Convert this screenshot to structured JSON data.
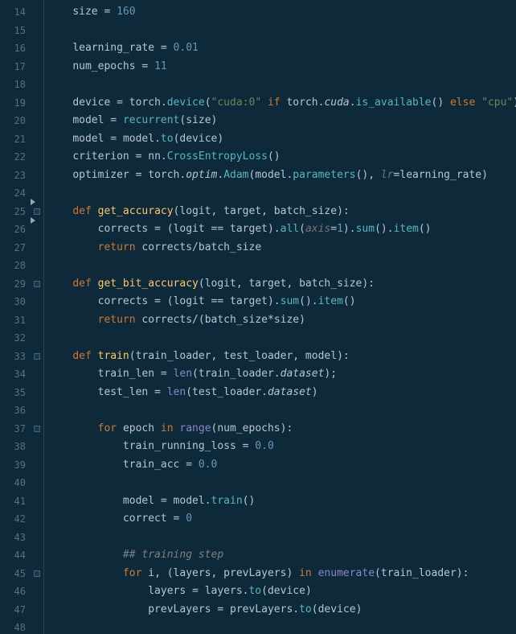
{
  "first_line_number": 14,
  "line_count": 35,
  "fold_markers": [
    25,
    29,
    33,
    37,
    45
  ],
  "triangle_markers": [
    24.5,
    25.5
  ],
  "lines": [
    [
      [
        "    ",
        ""
      ],
      [
        "size",
        "ident"
      ],
      [
        " = ",
        "op"
      ],
      [
        "160",
        "num"
      ]
    ],
    [],
    [
      [
        "    ",
        ""
      ],
      [
        "learning_rate",
        "ident"
      ],
      [
        " = ",
        "op"
      ],
      [
        "0.01",
        "num"
      ]
    ],
    [
      [
        "    ",
        ""
      ],
      [
        "num_epochs",
        "ident"
      ],
      [
        " = ",
        "op"
      ],
      [
        "11",
        "num"
      ]
    ],
    [],
    [
      [
        "    ",
        ""
      ],
      [
        "device",
        "ident"
      ],
      [
        " = ",
        "op"
      ],
      [
        "torch",
        "ident"
      ],
      [
        ".",
        "punct"
      ],
      [
        "device",
        "call"
      ],
      [
        "(",
        "punct"
      ],
      [
        "\"cuda:0\"",
        "str"
      ],
      [
        " ",
        "op"
      ],
      [
        "if",
        "kw"
      ],
      [
        " ",
        "op"
      ],
      [
        "torch",
        "ident"
      ],
      [
        ".",
        "punct"
      ],
      [
        "cuda",
        "itattr"
      ],
      [
        ".",
        "punct"
      ],
      [
        "is_available",
        "call"
      ],
      [
        "()",
        "punct"
      ],
      [
        " ",
        "op"
      ],
      [
        "else",
        "kw"
      ],
      [
        " ",
        "op"
      ],
      [
        "\"cpu\"",
        "str"
      ],
      [
        ")",
        "punct"
      ]
    ],
    [
      [
        "    ",
        ""
      ],
      [
        "model",
        "ident"
      ],
      [
        " = ",
        "op"
      ],
      [
        "recurrent",
        "call"
      ],
      [
        "(",
        "punct"
      ],
      [
        "size",
        "ident"
      ],
      [
        ")",
        "punct"
      ]
    ],
    [
      [
        "    ",
        ""
      ],
      [
        "model",
        "ident"
      ],
      [
        " = ",
        "op"
      ],
      [
        "model",
        "ident"
      ],
      [
        ".",
        "punct"
      ],
      [
        "to",
        "call"
      ],
      [
        "(",
        "punct"
      ],
      [
        "device",
        "ident"
      ],
      [
        ")",
        "punct"
      ]
    ],
    [
      [
        "    ",
        ""
      ],
      [
        "criterion",
        "ident"
      ],
      [
        " = ",
        "op"
      ],
      [
        "nn",
        "ident"
      ],
      [
        ".",
        "punct"
      ],
      [
        "CrossEntropyLoss",
        "call"
      ],
      [
        "()",
        "punct"
      ]
    ],
    [
      [
        "    ",
        ""
      ],
      [
        "optimizer",
        "ident"
      ],
      [
        " = ",
        "op"
      ],
      [
        "torch",
        "ident"
      ],
      [
        ".",
        "punct"
      ],
      [
        "optim",
        "itattr"
      ],
      [
        ".",
        "punct"
      ],
      [
        "Adam",
        "call"
      ],
      [
        "(",
        "punct"
      ],
      [
        "model",
        "ident"
      ],
      [
        ".",
        "punct"
      ],
      [
        "parameters",
        "call"
      ],
      [
        "()",
        "punct"
      ],
      [
        ", ",
        "punct"
      ],
      [
        "lr",
        "param"
      ],
      [
        "=",
        "op"
      ],
      [
        "learning_rate",
        "ident"
      ],
      [
        ")",
        "punct"
      ]
    ],
    [],
    [
      [
        "    ",
        ""
      ],
      [
        "def ",
        "kw"
      ],
      [
        "get_accuracy",
        "fname"
      ],
      [
        "(",
        "punct"
      ],
      [
        "logit",
        "ident"
      ],
      [
        ", ",
        "punct"
      ],
      [
        "target",
        "ident"
      ],
      [
        ", ",
        "punct"
      ],
      [
        "batch_size",
        "ident"
      ],
      [
        "):",
        "punct"
      ]
    ],
    [
      [
        "        ",
        ""
      ],
      [
        "corrects",
        "ident"
      ],
      [
        " = (",
        "op"
      ],
      [
        "logit",
        "ident"
      ],
      [
        " == ",
        "op"
      ],
      [
        "target",
        "ident"
      ],
      [
        ").",
        "punct"
      ],
      [
        "all",
        "call"
      ],
      [
        "(",
        "punct"
      ],
      [
        "axis",
        "param"
      ],
      [
        "=",
        "op"
      ],
      [
        "1",
        "num"
      ],
      [
        ").",
        "punct"
      ],
      [
        "sum",
        "call"
      ],
      [
        "().",
        "punct"
      ],
      [
        "item",
        "call"
      ],
      [
        "()",
        "punct"
      ]
    ],
    [
      [
        "        ",
        ""
      ],
      [
        "return ",
        "kw"
      ],
      [
        "corrects",
        "ident"
      ],
      [
        "/",
        "op"
      ],
      [
        "batch_size",
        "ident"
      ]
    ],
    [],
    [
      [
        "    ",
        ""
      ],
      [
        "def ",
        "kw"
      ],
      [
        "get_bit_accuracy",
        "fname"
      ],
      [
        "(",
        "punct"
      ],
      [
        "logit",
        "ident"
      ],
      [
        ", ",
        "punct"
      ],
      [
        "target",
        "ident"
      ],
      [
        ", ",
        "punct"
      ],
      [
        "batch_size",
        "ident"
      ],
      [
        "):",
        "punct"
      ]
    ],
    [
      [
        "        ",
        ""
      ],
      [
        "corrects",
        "ident"
      ],
      [
        " = (",
        "op"
      ],
      [
        "logit",
        "ident"
      ],
      [
        " == ",
        "op"
      ],
      [
        "target",
        "ident"
      ],
      [
        ").",
        "punct"
      ],
      [
        "sum",
        "call"
      ],
      [
        "().",
        "punct"
      ],
      [
        "item",
        "call"
      ],
      [
        "()",
        "punct"
      ]
    ],
    [
      [
        "        ",
        ""
      ],
      [
        "return ",
        "kw"
      ],
      [
        "corrects",
        "ident"
      ],
      [
        "/(",
        "op"
      ],
      [
        "batch_size",
        "ident"
      ],
      [
        "*",
        "op"
      ],
      [
        "size",
        "ident"
      ],
      [
        ")",
        "punct"
      ]
    ],
    [],
    [
      [
        "    ",
        ""
      ],
      [
        "def ",
        "kw"
      ],
      [
        "train",
        "fname"
      ],
      [
        "(",
        "punct"
      ],
      [
        "train_loader",
        "ident"
      ],
      [
        ", ",
        "punct"
      ],
      [
        "test_loader",
        "ident"
      ],
      [
        ", ",
        "punct"
      ],
      [
        "model",
        "ident"
      ],
      [
        "):",
        "punct"
      ]
    ],
    [
      [
        "        ",
        ""
      ],
      [
        "train_len",
        "ident"
      ],
      [
        " = ",
        "op"
      ],
      [
        "len",
        "builtin"
      ],
      [
        "(",
        "punct"
      ],
      [
        "train_loader",
        "ident"
      ],
      [
        ".",
        "punct"
      ],
      [
        "dataset",
        "itattr"
      ],
      [
        ");",
        "punct"
      ]
    ],
    [
      [
        "        ",
        ""
      ],
      [
        "test_len",
        "ident"
      ],
      [
        " = ",
        "op"
      ],
      [
        "len",
        "builtin"
      ],
      [
        "(",
        "punct"
      ],
      [
        "test_loader",
        "ident"
      ],
      [
        ".",
        "punct"
      ],
      [
        "dataset",
        "itattr"
      ],
      [
        ")",
        "punct"
      ]
    ],
    [],
    [
      [
        "        ",
        ""
      ],
      [
        "for ",
        "kw"
      ],
      [
        "epoch",
        "ident"
      ],
      [
        " ",
        "op"
      ],
      [
        "in ",
        "kw"
      ],
      [
        "range",
        "builtin"
      ],
      [
        "(",
        "punct"
      ],
      [
        "num_epochs",
        "ident"
      ],
      [
        "):",
        "punct"
      ]
    ],
    [
      [
        "            ",
        ""
      ],
      [
        "train_running_loss",
        "ident"
      ],
      [
        " = ",
        "op"
      ],
      [
        "0.0",
        "num"
      ]
    ],
    [
      [
        "            ",
        ""
      ],
      [
        "train_acc",
        "ident"
      ],
      [
        " = ",
        "op"
      ],
      [
        "0.0",
        "num"
      ]
    ],
    [],
    [
      [
        "            ",
        ""
      ],
      [
        "model",
        "ident"
      ],
      [
        " = ",
        "op"
      ],
      [
        "model",
        "ident"
      ],
      [
        ".",
        "punct"
      ],
      [
        "train",
        "call"
      ],
      [
        "()",
        "punct"
      ]
    ],
    [
      [
        "            ",
        ""
      ],
      [
        "correct",
        "ident"
      ],
      [
        " = ",
        "op"
      ],
      [
        "0",
        "num"
      ]
    ],
    [],
    [
      [
        "            ",
        ""
      ],
      [
        "## training step",
        "comment"
      ]
    ],
    [
      [
        "            ",
        ""
      ],
      [
        "for ",
        "kw"
      ],
      [
        "i",
        "ident"
      ],
      [
        ", (",
        "punct"
      ],
      [
        "layers",
        "ident"
      ],
      [
        ", ",
        "punct"
      ],
      [
        "prevLayers",
        "ident"
      ],
      [
        ") ",
        "punct"
      ],
      [
        "in ",
        "kw"
      ],
      [
        "enumerate",
        "builtin"
      ],
      [
        "(",
        "punct"
      ],
      [
        "train_loader",
        "ident"
      ],
      [
        "):",
        "punct"
      ]
    ],
    [
      [
        "                ",
        ""
      ],
      [
        "layers",
        "ident"
      ],
      [
        " = ",
        "op"
      ],
      [
        "layers",
        "ident"
      ],
      [
        ".",
        "punct"
      ],
      [
        "to",
        "call"
      ],
      [
        "(",
        "punct"
      ],
      [
        "device",
        "ident"
      ],
      [
        ")",
        "punct"
      ]
    ],
    [
      [
        "                ",
        ""
      ],
      [
        "prevLayers",
        "ident"
      ],
      [
        " = ",
        "op"
      ],
      [
        "prevLayers",
        "ident"
      ],
      [
        ".",
        "punct"
      ],
      [
        "to",
        "call"
      ],
      [
        "(",
        "punct"
      ],
      [
        "device",
        "ident"
      ],
      [
        ")",
        "punct"
      ]
    ],
    []
  ]
}
